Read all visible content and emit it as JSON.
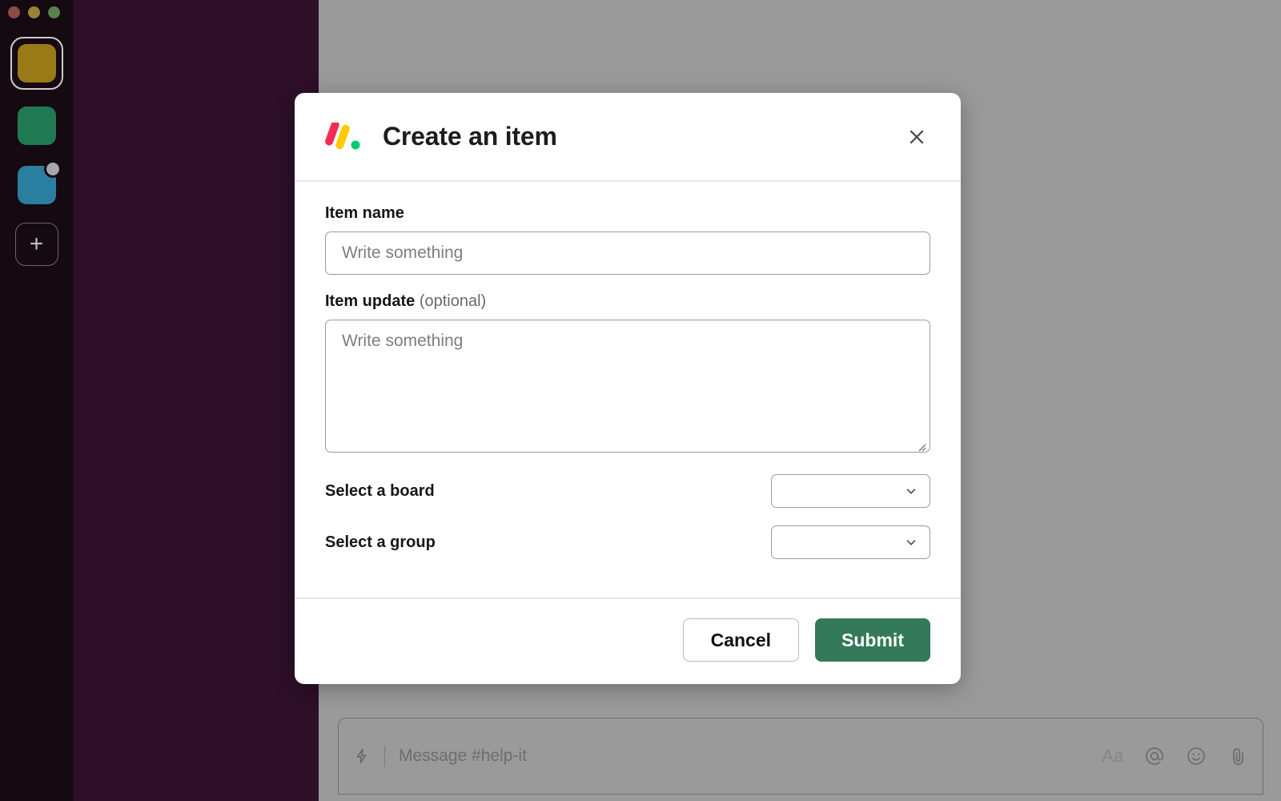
{
  "window": {
    "traffic_lights": [
      "close",
      "minimize",
      "maximize"
    ]
  },
  "sidebar": {
    "workspaces": [
      {
        "name": "workspace-gold",
        "color": "#9a7a16",
        "selected": true,
        "badge": false
      },
      {
        "name": "workspace-green",
        "color": "#1f7a53",
        "selected": false,
        "badge": false
      },
      {
        "name": "workspace-blue",
        "color": "#2a7fa0",
        "selected": false,
        "badge": true
      }
    ],
    "add_workspace_label": "+"
  },
  "composer": {
    "placeholder": "Message #help-it",
    "shortcut_icon": "lightning-bolt-icon",
    "format_label": "Aa",
    "mention_icon": "at-mention-icon",
    "emoji_icon": "emoji-icon",
    "attach_icon": "paperclip-icon"
  },
  "modal": {
    "title": "Create an item",
    "logo": "monday-logo-icon",
    "close_icon": "close-icon",
    "fields": {
      "item_name": {
        "label": "Item name",
        "placeholder": "Write something",
        "value": ""
      },
      "item_update": {
        "label": "Item update",
        "optional_suffix": "(optional)",
        "placeholder": "Write something",
        "value": ""
      },
      "select_board": {
        "label": "Select a board",
        "value": ""
      },
      "select_group": {
        "label": "Select a group",
        "value": ""
      }
    },
    "footer": {
      "cancel_label": "Cancel",
      "submit_label": "Submit"
    }
  },
  "colors": {
    "brand_pink": "#f62b54",
    "brand_yellow": "#ffcb00",
    "brand_green": "#00ca72",
    "submit_green": "#34795a",
    "sidebar_purple": "#2d0f28",
    "rail_dark": "#150912",
    "overlay_gray": "#9a9a9a"
  }
}
